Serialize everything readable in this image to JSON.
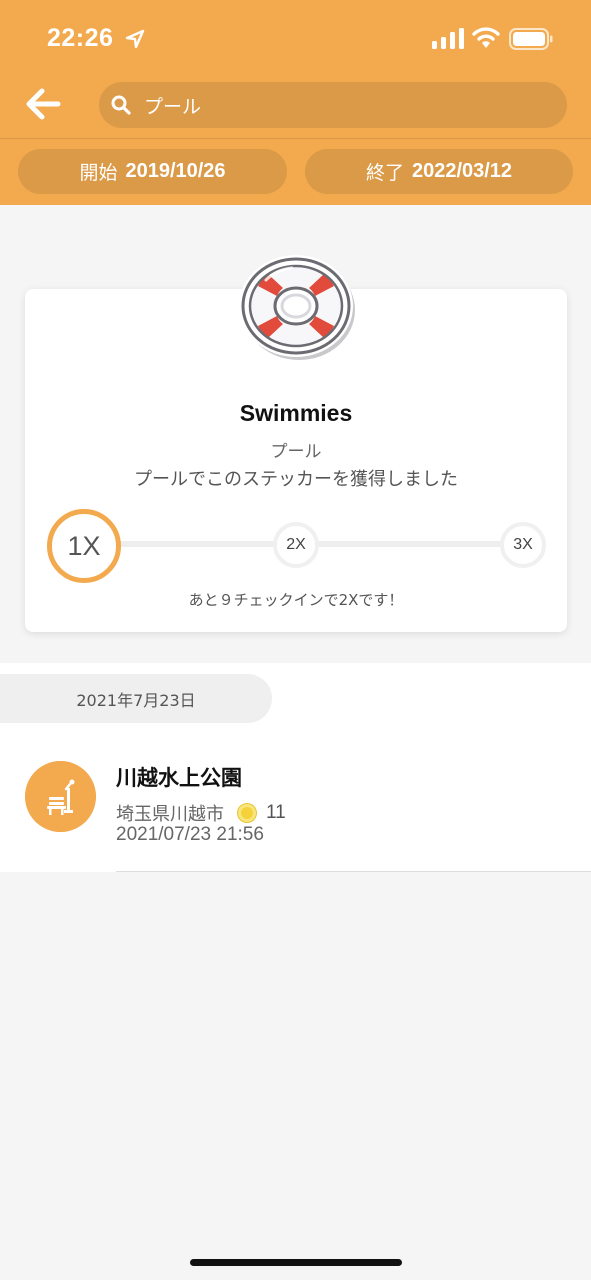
{
  "status_bar": {
    "time": "22:26"
  },
  "header": {
    "search_value": "プール",
    "start_label": "開始",
    "start_date": "2019/10/26",
    "end_label": "終了",
    "end_date": "2022/03/12"
  },
  "sticker": {
    "name": "Swimmies",
    "category": "プール",
    "description": "プールでこのステッカーを獲得しました",
    "levels": [
      "1X",
      "2X",
      "3X"
    ],
    "progress_note": "あと９チェックインで2Xです！",
    "icon": "life-ring-icon"
  },
  "checkins": {
    "date_header": "2021年7月23日",
    "items": [
      {
        "venue_name": "川越水上公園",
        "location": "埼玉県川越市",
        "points": "11",
        "datetime": "2021/07/23 21:56",
        "icon": "park-bench-icon"
      }
    ]
  },
  "colors": {
    "accent": "#f3a94d",
    "accent_dark": "#db9a48",
    "background": "#f5f5f5"
  }
}
